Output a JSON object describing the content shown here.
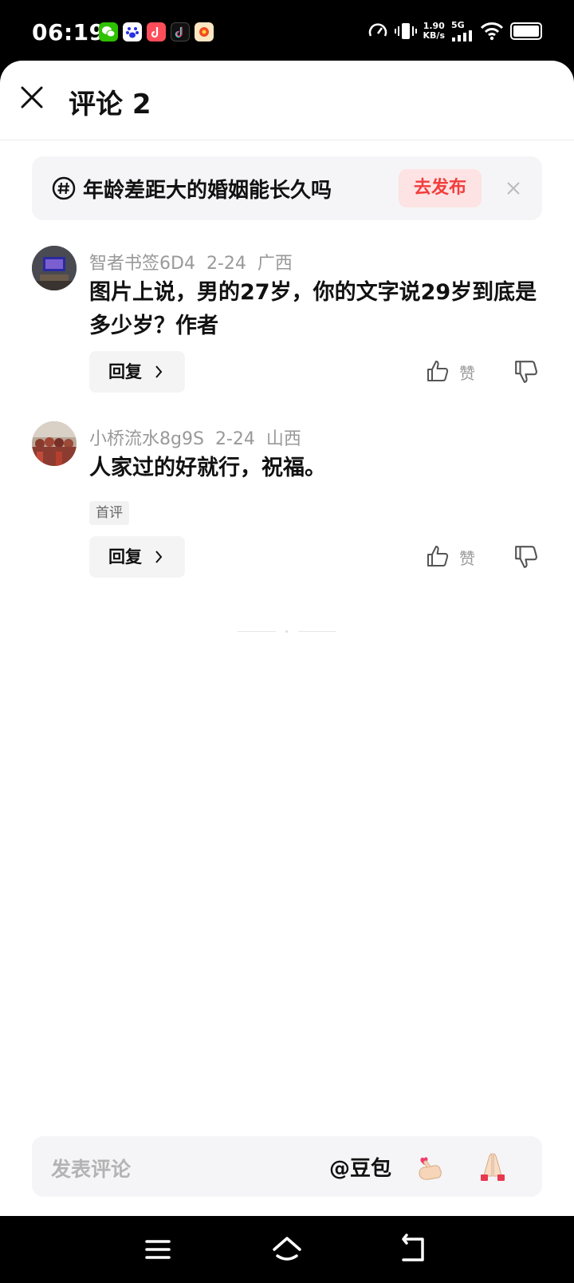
{
  "status_bar": {
    "time": "06:19",
    "net_speed_value": "1.90",
    "net_speed_unit": "KB/s",
    "network": "5G",
    "apps": [
      "wechat-icon",
      "baidu-icon",
      "xiaohongshu-icon",
      "douyin-icon",
      "toutiao-icon"
    ]
  },
  "header": {
    "title": "评论 2"
  },
  "topic": {
    "text": "年龄差距大的婚姻能长久吗",
    "publish_label": "去发布"
  },
  "comments": [
    {
      "username": "智者书签6D4",
      "date": "2-24",
      "location": "广西",
      "text": "图片上说，男的27岁，你的文字说29岁到底是多少岁？作者",
      "reply_label": "回复",
      "like_label": "赞"
    },
    {
      "username": "小桥流水8g9S",
      "date": "2-24",
      "location": "山西",
      "text": "人家过的好就行，祝福。",
      "tag": "首评",
      "reply_label": "回复",
      "like_label": "赞"
    }
  ],
  "comment_bar": {
    "placeholder": "发表评论",
    "mention": "@豆包"
  },
  "colors": {
    "accent": "#f23d3d",
    "accent_bg": "#fde3e3",
    "card_bg": "#f5f5f7"
  }
}
